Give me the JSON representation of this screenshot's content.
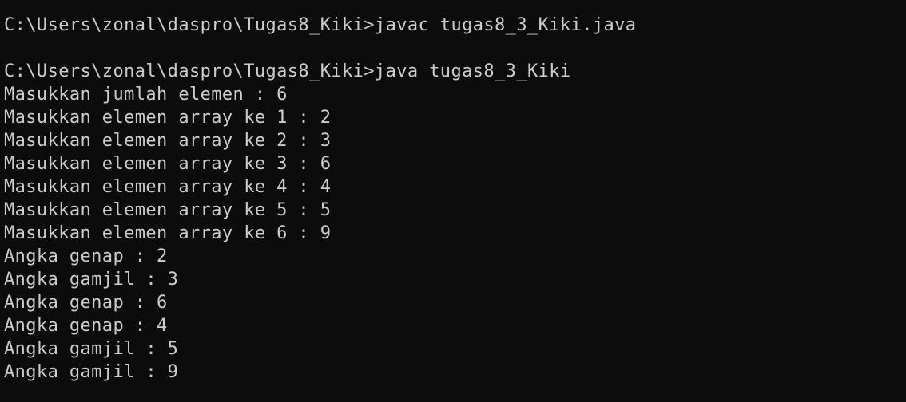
{
  "colors": {
    "background": "#0c0c0c",
    "foreground": "#cccccc"
  },
  "terminal": {
    "lines": [
      "C:\\Users\\zonal\\daspro\\Tugas8_Kiki>javac tugas8_3_Kiki.java",
      "",
      "C:\\Users\\zonal\\daspro\\Tugas8_Kiki>java tugas8_3_Kiki",
      "Masukkan jumlah elemen : 6",
      "Masukkan elemen array ke 1 : 2",
      "Masukkan elemen array ke 2 : 3",
      "Masukkan elemen array ke 3 : 6",
      "Masukkan elemen array ke 4 : 4",
      "Masukkan elemen array ke 5 : 5",
      "Masukkan elemen array ke 6 : 9",
      "Angka genap : 2",
      "Angka gamjil : 3",
      "Angka genap : 6",
      "Angka genap : 4",
      "Angka gamjil : 5",
      "Angka gamjil : 9"
    ]
  }
}
